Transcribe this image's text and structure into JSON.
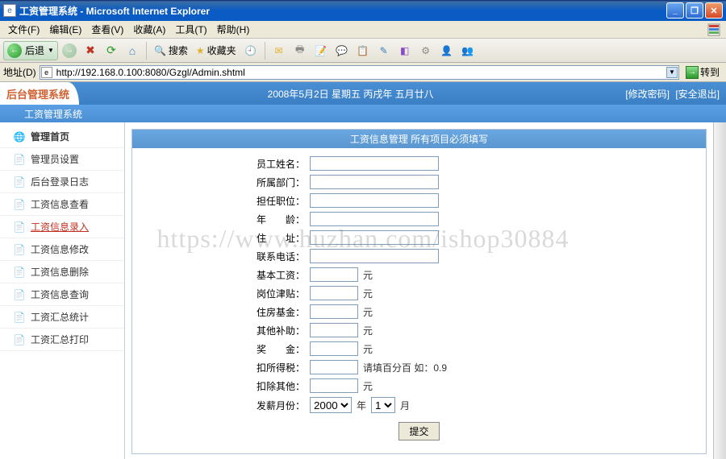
{
  "window": {
    "title": "工资管理系统 - Microsoft Internet Explorer"
  },
  "menu": {
    "file": "文件(F)",
    "edit": "编辑(E)",
    "view": "查看(V)",
    "favorites": "收藏(A)",
    "tools": "工具(T)",
    "help": "帮助(H)"
  },
  "toolbar": {
    "back": "后退",
    "search": "搜索",
    "favorites": "收藏夹"
  },
  "addressbar": {
    "label": "地址(D)",
    "url": "http://192.168.0.100:8080/Gzgl/Admin.shtml",
    "go": "转到"
  },
  "header": {
    "logo": "后台管理系统",
    "date": "2008年5月2日 星期五 丙戌年 五月廿八",
    "change_pwd": "[修改密码]",
    "logout": "[安全退出]",
    "subsystem": "工资管理系统"
  },
  "sidebar": {
    "items": [
      {
        "label": "管理首页",
        "icon": "🏠",
        "type": "home"
      },
      {
        "label": "管理员设置",
        "icon": "📄"
      },
      {
        "label": "后台登录日志",
        "icon": "📄"
      },
      {
        "label": "工资信息查看",
        "icon": "📄"
      },
      {
        "label": "工资信息录入",
        "icon": "📄",
        "active": true
      },
      {
        "label": "工资信息修改",
        "icon": "📄"
      },
      {
        "label": "工资信息删除",
        "icon": "📄"
      },
      {
        "label": "工资信息查询",
        "icon": "📄"
      },
      {
        "label": "工资汇总统计",
        "icon": "📄"
      },
      {
        "label": "工资汇总打印",
        "icon": "📄"
      }
    ]
  },
  "form": {
    "title": "工资信息管理 所有项目必须填写",
    "fields": {
      "name": "员工姓名：",
      "dept": "所属部门：",
      "position": "担任职位：",
      "age": "年　　龄：",
      "address": "住　　址：",
      "phone": "联系电话：",
      "base_salary": "基本工资：",
      "allowance": "岗位津贴：",
      "housing": "住房基金：",
      "other_subsidy": "其他补助：",
      "bonus": "奖　　金：",
      "tax": "扣所得税：",
      "other_deduct": "扣除其他：",
      "pay_month": "发薪月份："
    },
    "unit_yuan": "元",
    "unit_year": "年",
    "unit_month": "月",
    "tax_hint": "请填百分百 如：0.9",
    "year_value": "2000",
    "month_value": "1",
    "submit": "提交"
  },
  "watermark": "https://www.huzhan.com/ishop30884"
}
